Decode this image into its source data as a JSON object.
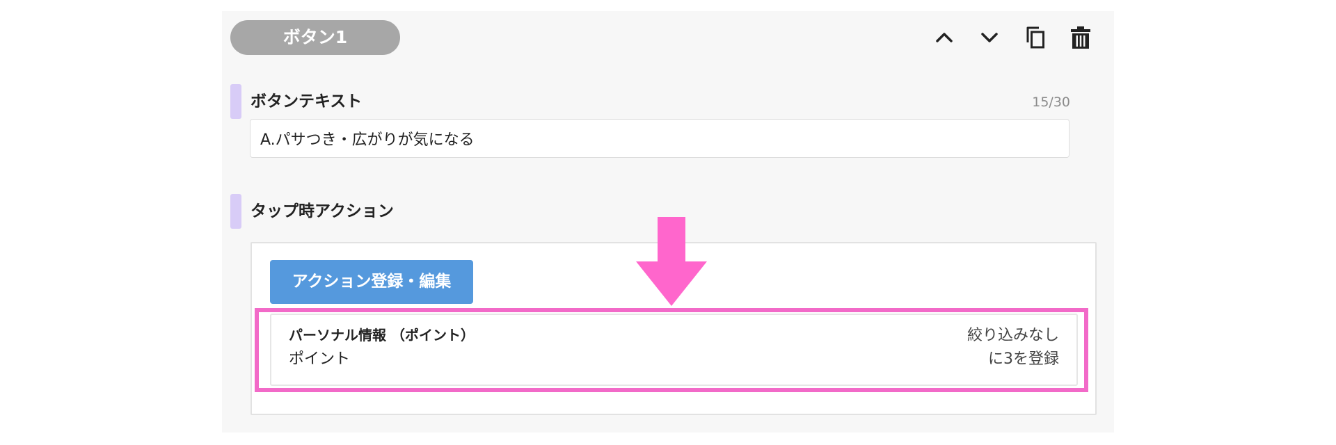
{
  "header": {
    "button_name": "ボタン1"
  },
  "toolbar": {
    "icons": [
      "chevron-up-icon",
      "chevron-down-icon",
      "copy-icon",
      "trash-icon"
    ]
  },
  "button_text_section": {
    "title": "ボタンテキスト",
    "counter": "15/30",
    "value": "A.パサつき・広がりが気になる"
  },
  "tap_action_section": {
    "title": "タップ時アクション",
    "register_button_label": "アクション登録・編集",
    "action": {
      "category": "パーソナル情報 （ポイント）",
      "name": "ポイント",
      "filter": "絞り込みなし",
      "register": "に3を登録"
    }
  },
  "colors": {
    "panel_background": "#f7f7f7",
    "pill_background": "#a7a7a7",
    "section_accent": "#d8ccf7",
    "primary_button": "#5599dd",
    "annotation_pink": "#ff66cc",
    "highlight_border": "#f26ac8"
  }
}
